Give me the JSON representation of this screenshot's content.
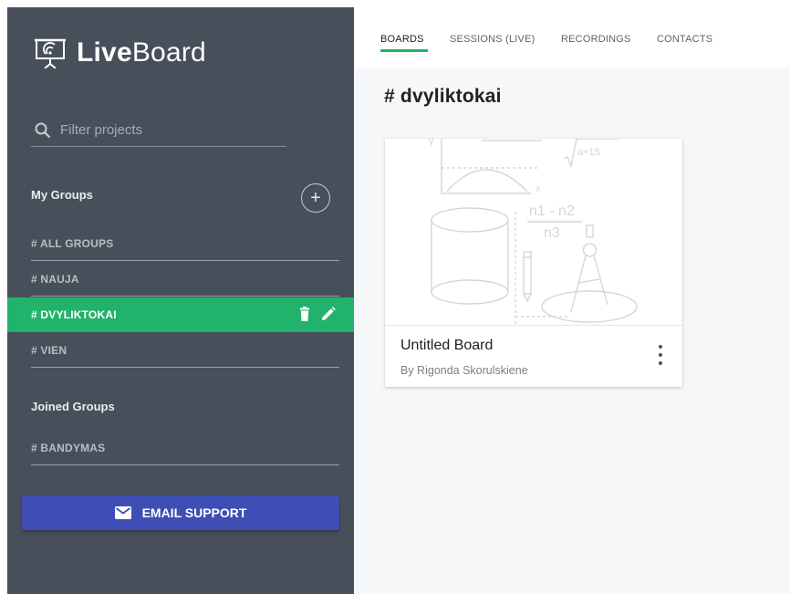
{
  "brand": {
    "bold": "Live",
    "light": "Board"
  },
  "filter": {
    "placeholder": "Filter projects",
    "value": ""
  },
  "my_groups": {
    "title": "My Groups",
    "items": [
      "# ALL GROUPS",
      "# NAUJA",
      "# DVYLIKTOKAI",
      "# VIEN"
    ],
    "active_index": 2
  },
  "joined_groups": {
    "title": "Joined Groups",
    "items": [
      "# BANDYMAS"
    ]
  },
  "email_support": {
    "label": "EMAIL SUPPORT"
  },
  "tabs": [
    "BOARDS",
    "SESSIONS (LIVE)",
    "RECORDINGS",
    "CONTACTS"
  ],
  "active_tab": "BOARDS",
  "main": {
    "heading": "# dvyliktokai"
  },
  "boards": [
    {
      "title": "Untitled Board",
      "author": "By Rigonda Skorulskiene"
    }
  ],
  "thumbnail_text": {
    "sqrt": "a+15",
    "frac_top": "n1 - n2",
    "frac_bottom": "n3",
    "axis_x": "x",
    "axis_y": "y"
  },
  "colors": {
    "sidebar": "#474f5a",
    "accent": "#21b36b",
    "email_button": "#3f4eb5",
    "background": "#f6f7f8"
  },
  "icons": [
    "presentation-board-icon",
    "search-icon",
    "plus-icon",
    "trash-icon",
    "pencil-icon",
    "mail-icon",
    "more-vertical-icon"
  ]
}
